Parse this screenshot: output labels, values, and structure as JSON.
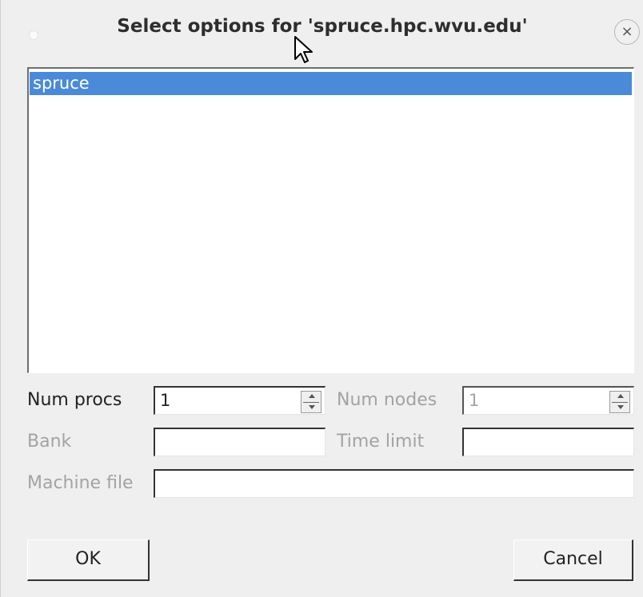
{
  "window": {
    "title": "Select options for 'spruce.hpc.wvu.edu'",
    "close_glyph": "×"
  },
  "machine_list": {
    "items": [
      "spruce"
    ],
    "selected_index": 0
  },
  "form": {
    "num_procs_label": "Num procs",
    "num_procs_value": "1",
    "num_nodes_label": "Num nodes",
    "num_nodes_value": "1",
    "bank_label": "Bank",
    "bank_value": "",
    "time_limit_label": "Time limit",
    "time_limit_value": "",
    "machine_file_label": "Machine file",
    "machine_file_value": ""
  },
  "buttons": {
    "ok_label": "OK",
    "cancel_label": "Cancel"
  },
  "colors": {
    "selection": "#4a8ad8",
    "background": "#efefef",
    "disabled_text": "#a3a3a3"
  }
}
